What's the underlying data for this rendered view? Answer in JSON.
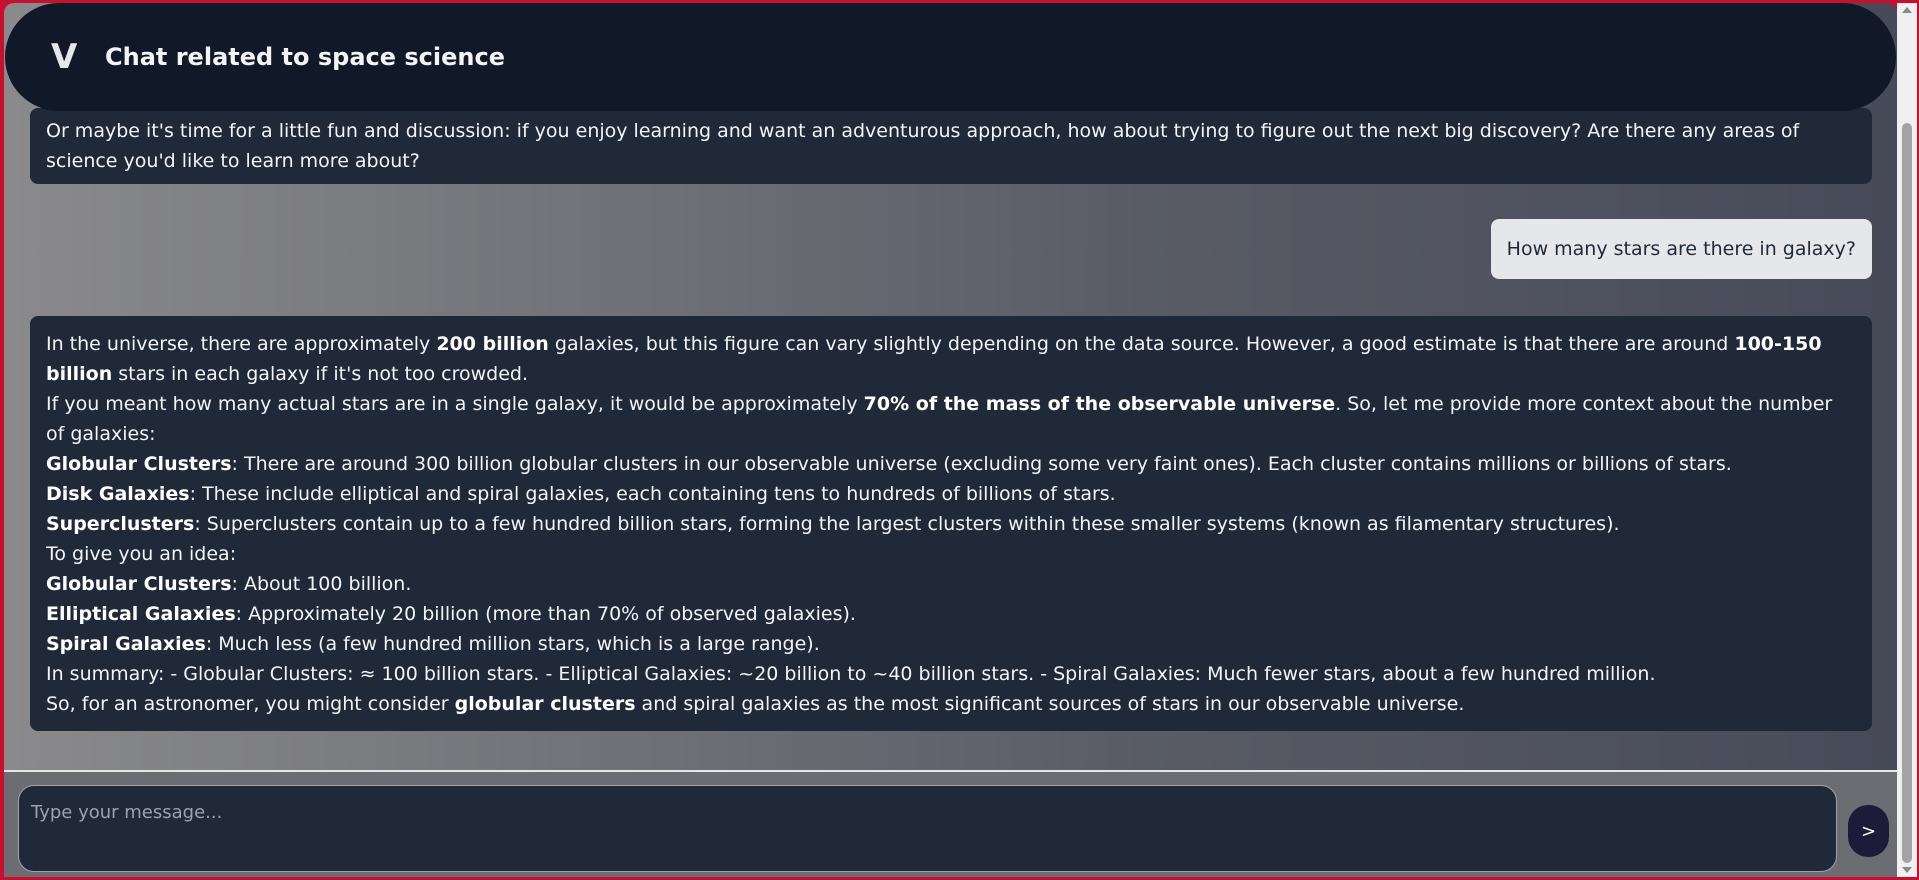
{
  "header": {
    "logo": "V",
    "title": "Chat related to space science"
  },
  "messages": {
    "prev_bot": "Or maybe it's time for a little fun and discussion: if you enjoy learning and want an adventurous approach, how about trying to figure out the next big discovery? Are there any areas of science you'd like to learn more about?",
    "user": "How many stars are there in galaxy?",
    "bot": {
      "p1_a": "In the universe, there are approximately ",
      "p1_b": "200 billion",
      "p1_c": " galaxies, but this figure can vary slightly depending on the data source. However, a good estimate is that there are around ",
      "p1_d": "100-150 billion",
      "p1_e": " stars in each galaxy if it's not too crowded.",
      "p2_a": "If you meant how many actual stars are in a single galaxy, it would be approximately ",
      "p2_b": "70% of the mass of the observable universe",
      "p2_c": ". So, let me provide more context about the number of galaxies:",
      "l1_b": "Globular Clusters",
      "l1_t": ": There are around 300 billion globular clusters in our observable universe (excluding some very faint ones). Each cluster contains millions or billions of stars.",
      "l2_b": "Disk Galaxies",
      "l2_t": ": These include elliptical and spiral galaxies, each containing tens to hundreds of billions of stars.",
      "l3_b": "Superclusters",
      "l3_t": ": Superclusters contain up to a few hundred billion stars, forming the largest clusters within these smaller systems (known as filamentary structures).",
      "idea": "To give you an idea:",
      "i1_b": "Globular Clusters",
      "i1_t": ": About 100 billion.",
      "i2_b": "Elliptical Galaxies",
      "i2_t": ": Approximately 20 billion (more than 70% of observed galaxies).",
      "i3_b": "Spiral Galaxies",
      "i3_t": ": Much less (a few hundred million stars, which is a large range).",
      "summary": "In summary: - Globular Clusters: ≈ 100 billion stars. - Elliptical Galaxies: ~20 billion to ~40 billion stars. - Spiral Galaxies: Much fewer stars, about a few hundred million.",
      "last_a": "So, for an astronomer, you might consider ",
      "last_b": "globular clusters",
      "last_c": " and spiral galaxies as the most significant sources of stars in our observable universe."
    }
  },
  "composer": {
    "placeholder": "Type your message...",
    "send_label": ">"
  }
}
